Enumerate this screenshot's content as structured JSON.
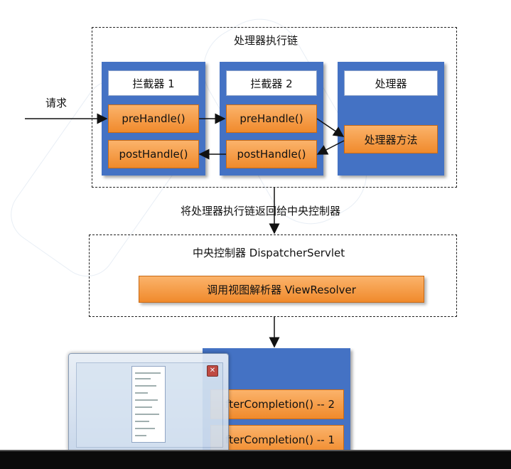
{
  "diagram": {
    "chain_title": "处理器执行链",
    "interceptor1_title": "拦截器 1",
    "interceptor2_title": "拦截器 2",
    "handler_title": "处理器",
    "pre_handle": "preHandle()",
    "post_handle": "postHandle()",
    "handler_method": "处理器方法",
    "request_label": "请求",
    "return_label": "将处理器执行链返回给中央控制器",
    "dispatcher_title": "中央控制器 DispatcherServlet",
    "view_resolver": "调用视图解析器 ViewResolver",
    "after_completion_2": "fterCompletion() -- 2",
    "after_completion_1": "fterCompletion() -- 1"
  },
  "preview_window": {
    "close_icon": "close-icon"
  }
}
